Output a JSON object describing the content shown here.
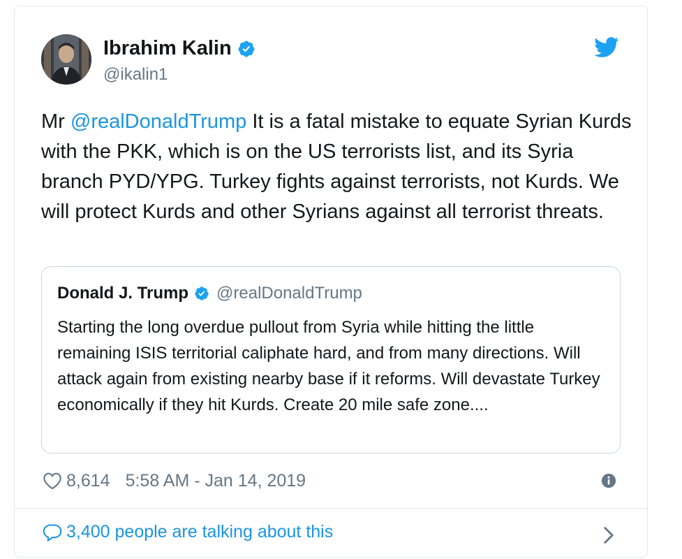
{
  "tweet": {
    "author_name": "Ibrahim Kalin",
    "author_handle": "@ikalin1",
    "text_prefix": "Mr ",
    "mention": "@realDonaldTrump",
    "text_body": " It is a fatal mistake to equate Syrian Kurds with the PKK, which is on the US terrorists list, and its Syria branch PYD/YPG. Turkey fights against terrorists, not Kurds. We will protect Kurds and other Syrians against all terrorist threats.",
    "likes": "8,614",
    "timestamp": "5:58 AM - Jan 14, 2019",
    "talking": "3,400 people are talking about this"
  },
  "quoted_tweet": {
    "author_name": "Donald J. Trump",
    "author_handle": "@realDonaldTrump",
    "text": "Starting the long overdue pullout from Syria while hitting the little remaining ISIS territorial caliphate hard, and from many directions. Will attack again from existing nearby base if it reforms. Will devastate Turkey economically if they hit Kurds. Create 20 mile safe zone...."
  },
  "icons": {
    "verified": "verified-icon",
    "brand": "twitter-bird-icon",
    "like": "heart-icon",
    "info": "info-icon",
    "reply": "speech-bubble-icon",
    "more": "chevron-right-icon"
  },
  "colors": {
    "accent": "#1b95e0",
    "verified": "#1da1f2",
    "muted": "#657786",
    "text": "#14171a",
    "border": "#e1e8ed"
  }
}
